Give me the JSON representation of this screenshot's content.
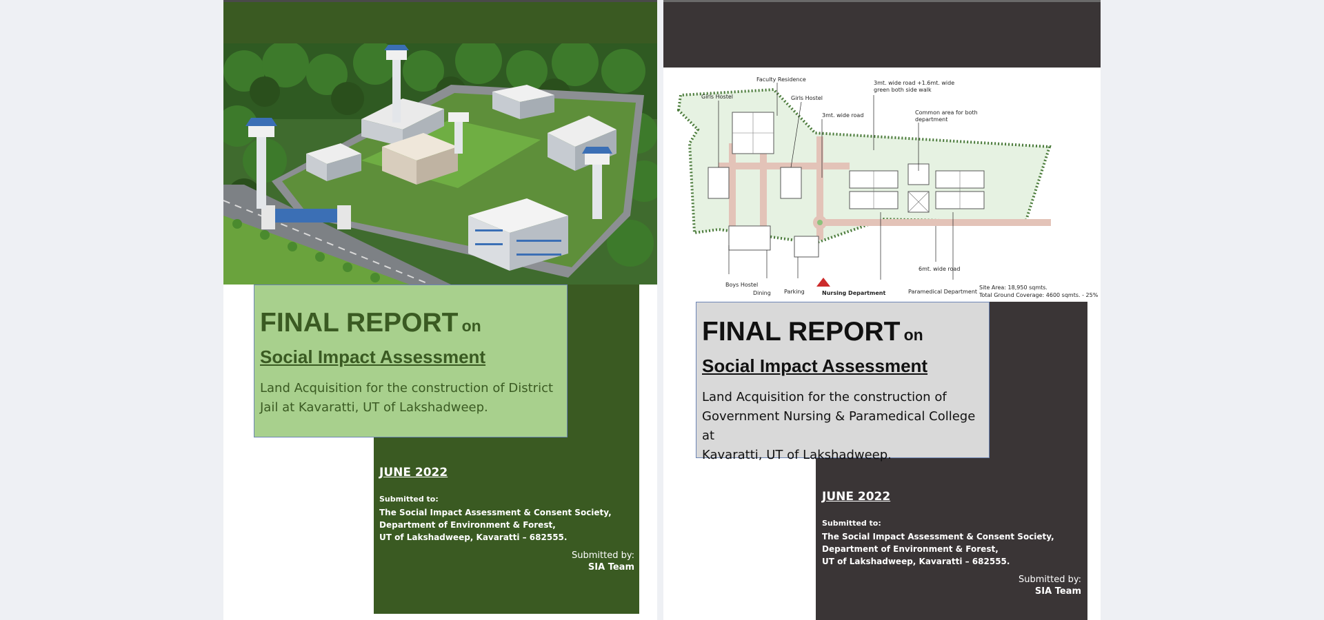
{
  "left_report": {
    "title": "FINAL REPORT",
    "title_on": "on",
    "subtitle": "Social Impact Assessment",
    "description_line1": "Land Acquisition for the construction of District",
    "description_line2": "Jail at Kavaratti, UT of Lakshadweep.",
    "date": "JUNE 2022",
    "submitted_to_label": "Submitted to:",
    "address_line1": "The Social Impact Assessment & Consent Society,",
    "address_line2": "Department of Environment & Forest,",
    "address_line3": "UT of Lakshadweep, Kavaratti – 682555.",
    "submitted_by_label": "Submitted by:",
    "submitted_by": "SIA Team",
    "colors": {
      "accent": "#3a5a22",
      "title_box": "#a8d08d",
      "title_text": "#3a5a22"
    }
  },
  "right_report": {
    "title": "FINAL REPORT",
    "title_on": "on",
    "subtitle": "Social Impact Assessment",
    "description_line1": "Land Acquisition for the construction of",
    "description_line2": "Government Nursing & Paramedical College at",
    "description_line3": "Kavaratti, UT of Lakshadweep.",
    "date": "JUNE 2022",
    "submitted_to_label": "Submitted to:",
    "address_line1": "The Social Impact Assessment & Consent Society,",
    "address_line2": "Department of Environment & Forest,",
    "address_line3": "UT of Lakshadweep, Kavaratti – 682555.",
    "submitted_by_label": "Submitted by:",
    "submitted_by": "SIA Team",
    "colors": {
      "accent": "#3a3536",
      "title_box": "#d9d9d9",
      "title_text": "#111111"
    }
  },
  "site_plan": {
    "labels": {
      "faculty_residence": "Faculty Residence",
      "girls_hostel_1": "Girls Hostel",
      "girls_hostel_2": "Girls Hostel",
      "road_3mt": "3mt. wide road",
      "road_3mt_green_1": "3mt. wide road +1.6mt. wide",
      "road_3mt_green_2": "green both side walk",
      "common_area_1": "Common area for both",
      "common_area_2": "department",
      "road_6mt": "6mt. wide road",
      "boys_hostel": "Boys Hostel",
      "dining": "Dining",
      "parking": "Parking",
      "nursing_department": "Nursing Department",
      "paramedical_department": "Paramedical Department",
      "site_area": "Site Area: 18,950 sqmts.",
      "ground_coverage": "Total Ground Coverage: 4600 sqmts.  -  25%"
    }
  }
}
